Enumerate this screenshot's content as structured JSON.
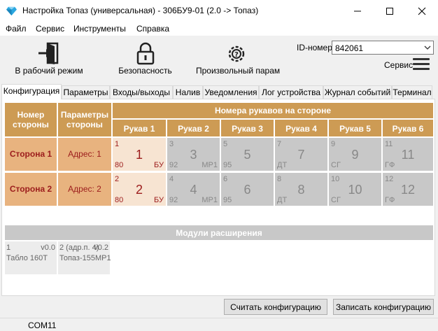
{
  "window": {
    "title": "Настройка Топаз (универсальная) - 306БУ9-01 (2.0 -> Топаз)",
    "app_icon": "diamond-icon"
  },
  "menu": [
    "Файл",
    "Сервис",
    "Инструменты",
    "Справка"
  ],
  "toolbar": {
    "work_mode": "В рабочий режим",
    "security": "Безопасность",
    "arbitrary_param": "Произвольный парам",
    "id_label": "ID-номер",
    "id_value": "842061",
    "service_label": "Сервис"
  },
  "tabs": [
    "Конфигурация",
    "Параметры",
    "Входы/выходы",
    "Налив",
    "Уведомления",
    "Лог устройства",
    "Журнал событий",
    "Терминал"
  ],
  "active_tab": "Конфигурация",
  "grid": {
    "col_side_number": "Номер стороны",
    "col_side_params": "Параметры стороны",
    "nozzles_header": "Номера рукавов на стороне",
    "nozzle_headers": [
      "Рукав 1",
      "Рукав 2",
      "Рукав 3",
      "Рукав 4",
      "Рукав 5",
      "Рукав 6"
    ],
    "sides": [
      {
        "name": "Сторона 1",
        "address": "Адрес: 1",
        "nozzles": [
          {
            "small": "1",
            "big": "1",
            "bl": "80",
            "br": "БУ",
            "active": true
          },
          {
            "small": "3",
            "big": "3",
            "bl": "92",
            "br": "МР1",
            "active": false
          },
          {
            "small": "5",
            "big": "5",
            "bl": "95",
            "br": "",
            "active": false
          },
          {
            "small": "7",
            "big": "7",
            "bl": "ДТ",
            "br": "",
            "active": false
          },
          {
            "small": "9",
            "big": "9",
            "bl": "СГ",
            "br": "",
            "active": false
          },
          {
            "small": "11",
            "big": "11",
            "bl": "ГФ",
            "br": "",
            "active": false
          }
        ]
      },
      {
        "name": "Сторона 2",
        "address": "Адрес: 2",
        "nozzles": [
          {
            "small": "2",
            "big": "2",
            "bl": "80",
            "br": "БУ",
            "active": true
          },
          {
            "small": "4",
            "big": "4",
            "bl": "92",
            "br": "МР1",
            "active": false
          },
          {
            "small": "6",
            "big": "6",
            "bl": "95",
            "br": "",
            "active": false
          },
          {
            "small": "8",
            "big": "8",
            "bl": "ДТ",
            "br": "",
            "active": false
          },
          {
            "small": "10",
            "big": "10",
            "bl": "СГ",
            "br": "",
            "active": false
          },
          {
            "small": "12",
            "big": "12",
            "bl": "ГФ",
            "br": "",
            "active": false
          }
        ]
      }
    ]
  },
  "modules": {
    "header": "Модули расширения",
    "items": [
      {
        "num": "1",
        "ver": "v0.0",
        "name": "Табло 160Т"
      },
      {
        "num": "2 (адр.п. 4)",
        "ver": "v0.2",
        "name": "Топаз-155МР1"
      }
    ]
  },
  "buttons": {
    "read": "Считать конфигурацию",
    "write": "Записать конфигурацию"
  },
  "status": {
    "port": "COM11"
  },
  "colors": {
    "header_brown": "#cd9b54",
    "side_cell": "#e8b37f",
    "active_nozzle": "#f7e4d2",
    "inactive_nozzle": "#c8c8c8",
    "dark_red_text": "#9c1c1c"
  }
}
